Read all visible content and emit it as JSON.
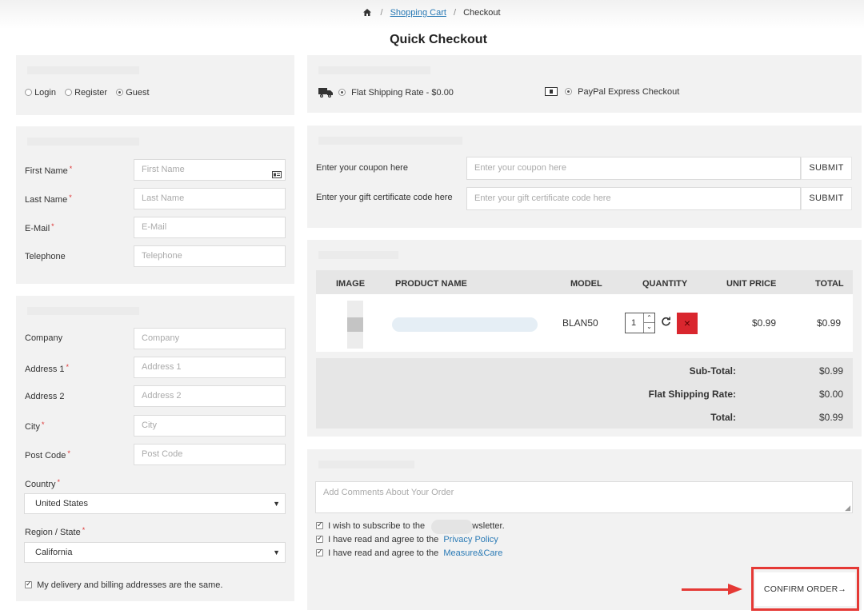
{
  "breadcrumb": {
    "cart": "Shopping Cart",
    "current": "Checkout"
  },
  "title": "Quick Checkout",
  "account": {
    "options": [
      "Login",
      "Register",
      "Guest"
    ],
    "selected": "Guest"
  },
  "shipping": {
    "label": "Flat Shipping Rate - $0.00"
  },
  "payment": {
    "label": "PayPal Express Checkout"
  },
  "personal": {
    "first_name": {
      "label": "First Name",
      "placeholder": "First Name"
    },
    "last_name": {
      "label": "Last Name",
      "placeholder": "Last Name"
    },
    "email": {
      "label": "E-Mail",
      "placeholder": "E-Mail"
    },
    "telephone": {
      "label": "Telephone",
      "placeholder": "Telephone"
    }
  },
  "address": {
    "company": {
      "label": "Company",
      "placeholder": "Company"
    },
    "address1": {
      "label": "Address 1",
      "placeholder": "Address 1"
    },
    "address2": {
      "label": "Address 2",
      "placeholder": "Address 2"
    },
    "city": {
      "label": "City",
      "placeholder": "City"
    },
    "postcode": {
      "label": "Post Code",
      "placeholder": "Post Code"
    },
    "country": {
      "label": "Country",
      "value": "United States"
    },
    "region": {
      "label": "Region / State",
      "value": "California"
    },
    "same_address": "My delivery and billing addresses are the same."
  },
  "coupon": {
    "coupon_label": "Enter your coupon here",
    "coupon_placeholder": "Enter your coupon here",
    "gift_label": "Enter your gift certificate code here",
    "gift_placeholder": "Enter your gift certificate code here",
    "submit": "SUBMIT"
  },
  "cart": {
    "headers": {
      "image": "IMAGE",
      "product": "PRODUCT NAME",
      "model": "MODEL",
      "quantity": "QUANTITY",
      "unit_price": "UNIT PRICE",
      "total": "TOTAL"
    },
    "row": {
      "model": "BLAN50",
      "quantity": "1",
      "unit_price": "$0.99",
      "total": "$0.99",
      "remove": "×"
    },
    "totals": {
      "subtotal_label": "Sub-Total:",
      "subtotal": "$0.99",
      "shipping_label": "Flat Shipping Rate:",
      "shipping": "$0.00",
      "total_label": "Total:",
      "total": "$0.99"
    }
  },
  "confirm": {
    "comments_placeholder": "Add Comments About Your Order",
    "newsletter_prefix": "I wish to subscribe to the",
    "newsletter_suffix": "ewsletter.",
    "privacy_prefix": "I have read and agree to the",
    "privacy_link": "Privacy Policy",
    "terms_prefix": "I have read and agree to the",
    "terms_link": "Measure&Care",
    "button": "CONFIRM ORDER",
    "arrow": "→"
  },
  "colors": {
    "link": "#2a7ab5",
    "remove": "#d9262e",
    "highlight": "#e53935",
    "panel": "#f2f2f2"
  }
}
